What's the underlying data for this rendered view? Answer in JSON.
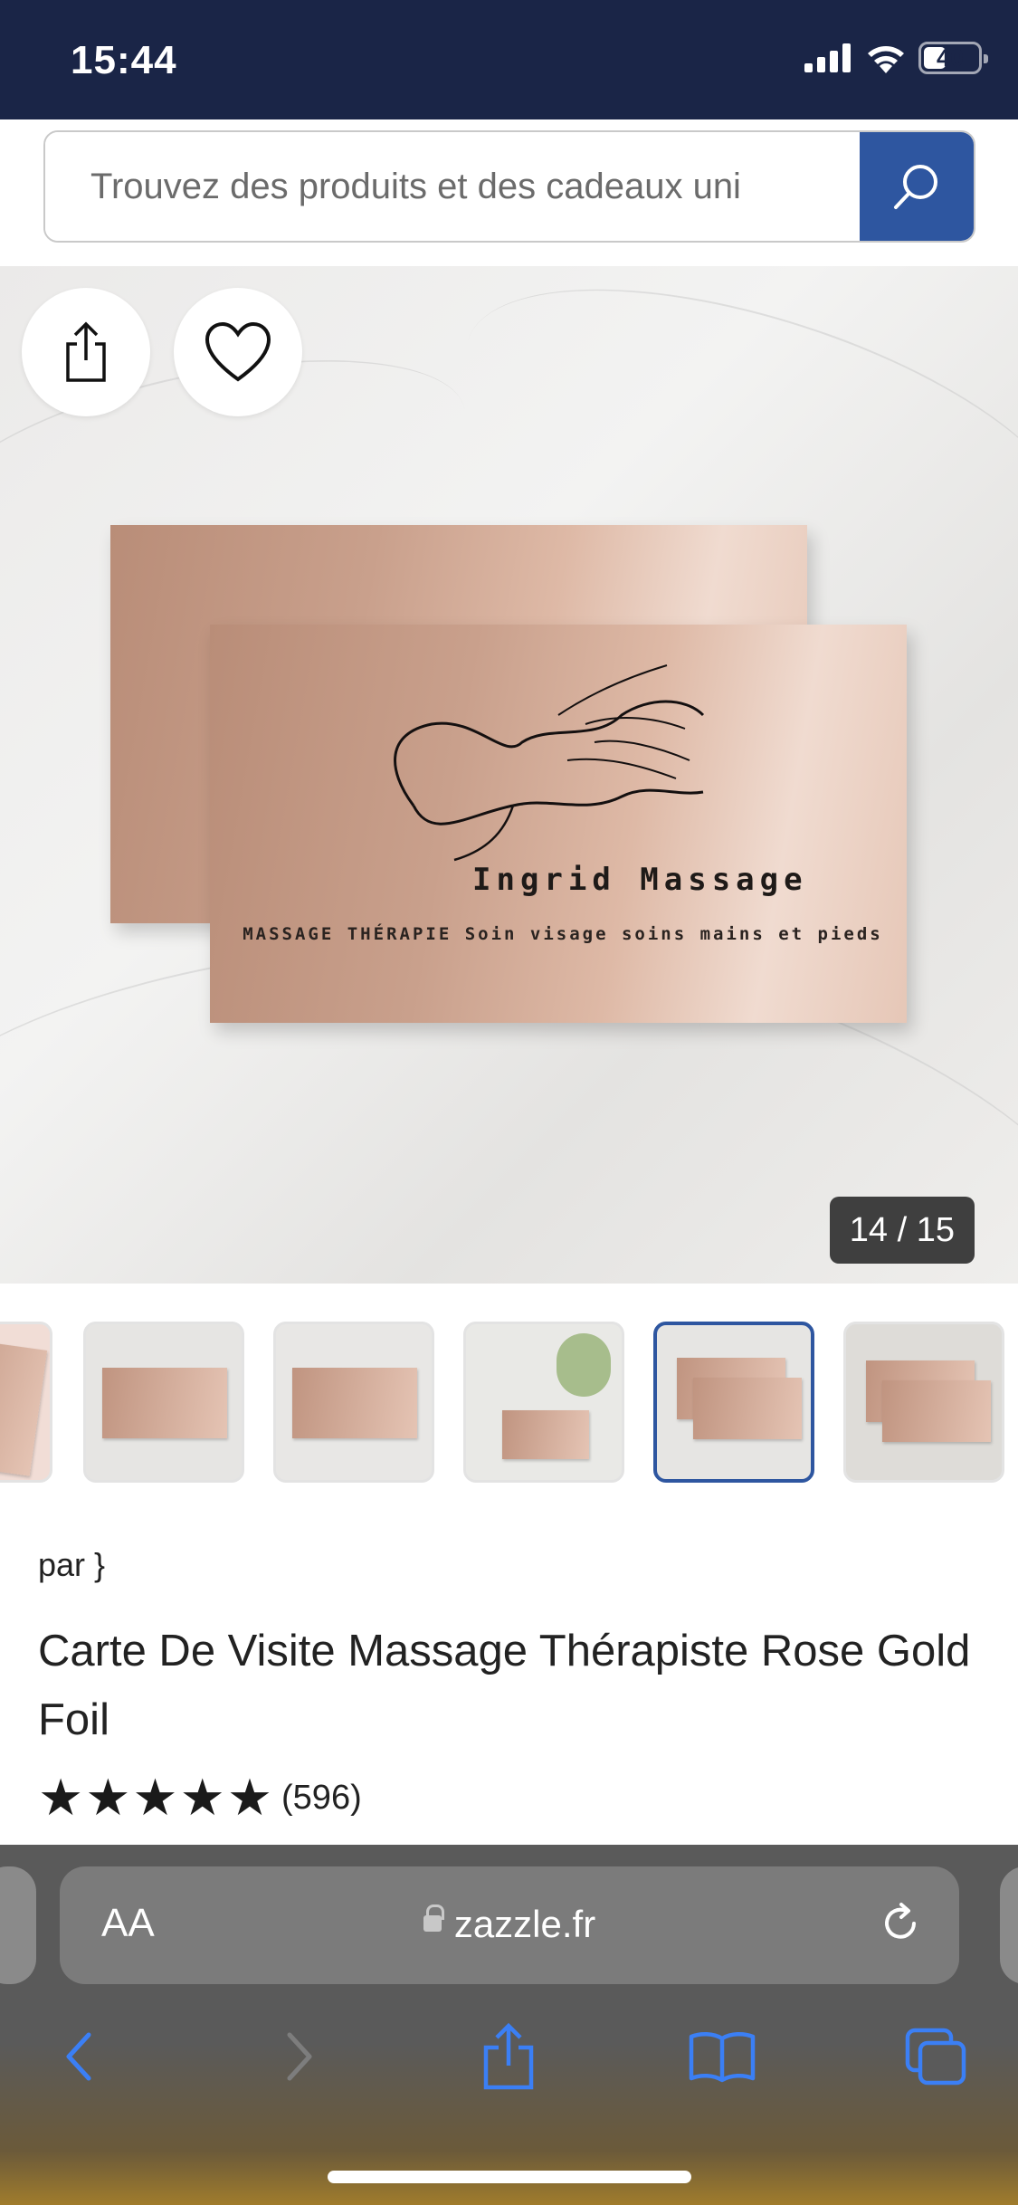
{
  "status_bar": {
    "time": "15:44",
    "battery": "40"
  },
  "search": {
    "placeholder": "Trouvez des produits et des cadeaux uni"
  },
  "hero": {
    "card_brand": "Ingrid Massage",
    "card_tagline": "MASSAGE THÉRAPIE Soin visage soins mains et pieds",
    "counter": "14 / 15"
  },
  "product": {
    "by": "par }",
    "title": "Carte De Visite Massage Thérapiste Rose Gold Foil",
    "rating_stars": 5,
    "rating_count": "(596)"
  },
  "browser": {
    "aa_label": "AA",
    "domain": "zazzle.fr"
  },
  "icons": {
    "share": "share-icon",
    "favorite": "heart-icon",
    "search": "search-icon",
    "back": "chevron-left-icon",
    "forward": "chevron-right-icon",
    "bookmarks": "book-icon",
    "tabs": "tabs-icon",
    "reload": "reload-icon",
    "lock": "lock-icon"
  },
  "colors": {
    "status_bar": "#1a2547",
    "accent": "#2e56a0",
    "safari_bar": "#5a5a5a"
  }
}
